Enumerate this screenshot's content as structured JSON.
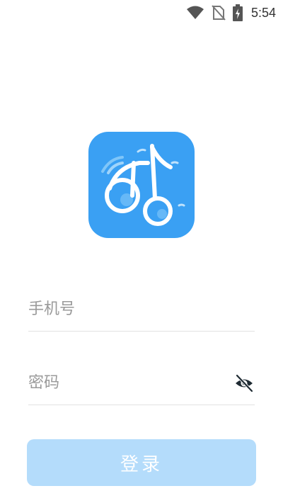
{
  "status_bar": {
    "time": "5:54",
    "icons": [
      "wifi-icon",
      "no-sim-icon",
      "battery-charging-icon"
    ]
  },
  "logo": {
    "icon": "music-note-logo-icon",
    "color": "#3aa0f3"
  },
  "form": {
    "phone_placeholder": "手机号",
    "phone_value": "",
    "password_placeholder": "密码",
    "password_value": "",
    "visibility_icon": "eye-off-icon"
  },
  "login_button": {
    "label": "登录",
    "color": "#b4dcfb"
  }
}
